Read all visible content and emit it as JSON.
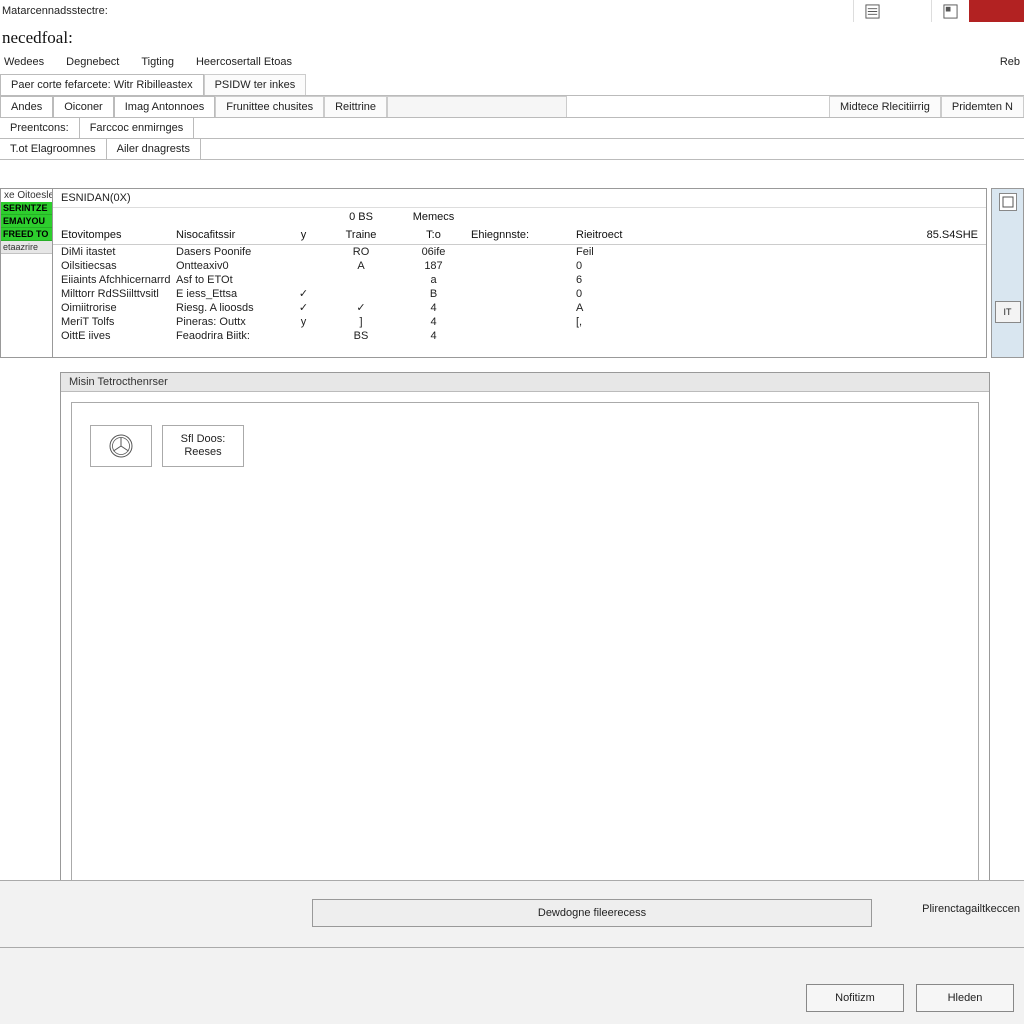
{
  "top": {
    "label": "Matarcennadsstectre:"
  },
  "title": "necedfoal:",
  "menu": {
    "items": [
      "Wedees",
      "Degnebect",
      "Tigting",
      "Heercosertall Etoas"
    ],
    "right": "Reb"
  },
  "tabs1": {
    "items": [
      "Paer corte  fefarcete: Witr  Ribilleastex",
      "PSIDW ter inkes"
    ]
  },
  "tabs2": {
    "items": [
      "Andes",
      "Oiconer",
      "Imag Antonnoes",
      "Frunittee chusites",
      "Reittrine"
    ]
  },
  "tabs2_right": {
    "items": [
      "Midtece Rlecitiirrig",
      "Pridemten N"
    ]
  },
  "tabs3": {
    "items": [
      "Preentcons:",
      "Farccoc enmirnges"
    ]
  },
  "tabs4": {
    "items": [
      "T.ot Elagroomnes",
      "Ailer dnagrests"
    ]
  },
  "sidebar": {
    "header": "xe Oitoesle",
    "items": [
      "SERINTZE",
      "EMAIYOU",
      "FREED TO"
    ],
    "footer": "etaazrire"
  },
  "table": {
    "title": "ESNIDAN(0X)",
    "subhdr": {
      "a": "0  BS",
      "b": "Memecs"
    },
    "columns": [
      "Etovitompes",
      "Nisocafitssir",
      "",
      "Traine",
      "T:o",
      "Ehiegnnste:",
      "Rieitroect",
      "85.S4SHE"
    ],
    "rows": [
      [
        "DiMi itastet",
        "Dasers Poonife",
        "",
        "RO",
        "06ife",
        "",
        "Feil",
        ""
      ],
      [
        "Oilsitiecsas",
        "Ontteaxiv0",
        "",
        "A",
        "187",
        "",
        "0",
        ""
      ],
      [
        "Eiiaints Afchhicernarrd",
        "Asf to  ETOt",
        "",
        "",
        "a",
        "",
        "6",
        ""
      ],
      [
        "Milttorr RdSSiilttvsitl",
        "E  iess_Ettsa",
        "✓",
        "",
        "B",
        "",
        "0",
        ""
      ],
      [
        "Oimiitrorise",
        "Riesg. A lioosds",
        "✓",
        "✓",
        "4",
        "",
        "A",
        ""
      ],
      [
        "MeriT Tolfs",
        "Pineras: Outtx",
        "y",
        "]",
        "4",
        "",
        "[,",
        ""
      ],
      [
        "OittE iives",
        "Feaodrira  Biitk:",
        "",
        "BS",
        "4",
        "",
        "",
        ""
      ]
    ],
    "mark_col0": "y"
  },
  "rightpane": {
    "top_icon": "□",
    "btn": "IT"
  },
  "lower": {
    "header": "Misin Tetrocthenrser",
    "box_line1": "Sfl Doos:",
    "box_line2": "Reeses"
  },
  "footer": {
    "main_btn": "Dewdogne fileerecess",
    "right_label": "Plirenctagailtkeccen",
    "btn1": "Nofitizm",
    "btn2": "Hleden"
  }
}
